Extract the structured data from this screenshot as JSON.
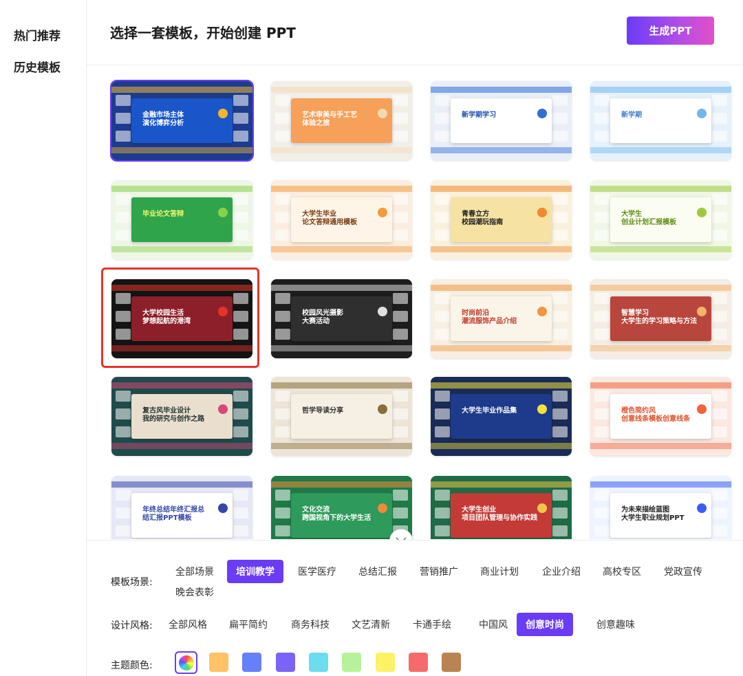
{
  "sidebar": {
    "items": [
      {
        "label": "热门推荐"
      },
      {
        "label": "历史模板"
      }
    ]
  },
  "header": {
    "title": "选择一套模板，开始创建 PPT",
    "generate_label": "生成PPT"
  },
  "templates": [
    {
      "title": "金融市场主体\n演化博弈分析",
      "bg": "#1d3c8f",
      "panel": "#1a56c9",
      "accent": "#f3b52c",
      "text": "#ffffff"
    },
    {
      "title": "艺术审美与手工艺\n体验之旅",
      "bg": "#f2efe9",
      "panel": "#f6a05a",
      "accent": "#f4d9b5",
      "text": "#ffffff"
    },
    {
      "title": "新学期学习",
      "bg": "#e9eef7",
      "panel": "#ffffff",
      "accent": "#2f6fd6",
      "text": "#1e4fb3"
    },
    {
      "title": "新学期",
      "bg": "#e6f1fb",
      "panel": "#ffffff",
      "accent": "#6fb7ee",
      "text": "#3d7fd0"
    },
    {
      "title": "毕业论文答辩",
      "bg": "#eef6e6",
      "panel": "#2fa44b",
      "accent": "#89d14b",
      "text": "#f4f86a"
    },
    {
      "title": "大学生毕业\n论文答辩通用模板",
      "bg": "#fbeee1",
      "panel": "#fff4e8",
      "accent": "#f29a3c",
      "text": "#7a3b10"
    },
    {
      "title": "青春立方\n校园潮玩指南",
      "bg": "#faf1dd",
      "panel": "#f6e2a3",
      "accent": "#f08a2d",
      "text": "#222222"
    },
    {
      "title": "大学生\n创业计划汇报模板",
      "bg": "#f1f7e6",
      "panel": "#fbfdf2",
      "accent": "#9ccb3c",
      "text": "#5f8f14"
    },
    {
      "title": "大学校园生活\n梦想起航的港湾",
      "bg": "#141414",
      "panel": "#8c1f2a",
      "accent": "#e6332a",
      "text": "#ffffff"
    },
    {
      "title": "校园风光摄影\n大赛活动",
      "bg": "#1d1d1d",
      "panel": "#2f2f2f",
      "accent": "#e0e0e0",
      "text": "#ffffff"
    },
    {
      "title": "时尚前沿\n潮流服饰产品介绍",
      "bg": "#f7efe2",
      "panel": "#fbf4e8",
      "accent": "#f09640",
      "text": "#c0392b"
    },
    {
      "title": "智慧学习\n大学生的学习策略与方法",
      "bg": "#f4ede4",
      "panel": "#b8463d",
      "accent": "#f2b36a",
      "text": "#ffffff"
    },
    {
      "title": "复古风毕业设计\n我的研究与创作之路",
      "bg": "#1f4b4b",
      "panel": "#eadfcf",
      "accent": "#d8477a",
      "text": "#233"
    },
    {
      "title": "哲学导读分享",
      "bg": "#ece4d6",
      "panel": "#f6f0e4",
      "accent": "#8a6d3b",
      "text": "#333333"
    },
    {
      "title": "大学生毕业作品集",
      "bg": "#1b2b57",
      "panel": "#1e3a8a",
      "accent": "#f4e23a",
      "text": "#ffffff"
    },
    {
      "title": "橙色简约风\n创意线条模板创意线条",
      "bg": "#fbe8e0",
      "panel": "#ffffff",
      "accent": "#f0643c",
      "text": "#e0532c"
    },
    {
      "title": "年终总结年终汇报总\n结汇报PPT模板",
      "bg": "#e6e8f6",
      "panel": "#ffffff",
      "accent": "#3446a8",
      "text": "#3446a8"
    },
    {
      "title": "文化交流\n跨国视角下的大学生活",
      "bg": "#1f7a48",
      "panel": "#2e9a5b",
      "accent": "#ef8a3c",
      "text": "#ffffff"
    },
    {
      "title": "大学生创业\n项目团队管理与协作实践",
      "bg": "#1e6b46",
      "panel": "#c33a36",
      "accent": "#f2c54a",
      "text": "#ffffff"
    },
    {
      "title": "为未来描绘蓝图\n大学生职业规划PPT",
      "bg": "#eef4ff",
      "panel": "#ffffff",
      "accent": "#3b5cf6",
      "text": "#222222"
    }
  ],
  "filters": {
    "scene": {
      "label": "模板场景:",
      "options": [
        "全部场景",
        "培训教学",
        "医学医疗",
        "总结汇报",
        "营销推广",
        "商业计划",
        "企业介绍",
        "高校专区",
        "党政宣传",
        "晚会表彰"
      ],
      "selected": "培训教学"
    },
    "style": {
      "label": "设计风格:",
      "options": [
        "全部风格",
        "扁平简约",
        "商务科技",
        "文艺清新",
        "卡通手绘",
        "中国风",
        "创意时尚",
        "创意趣味"
      ],
      "selected": "创意时尚"
    },
    "color": {
      "label": "主题颜色:",
      "swatches": [
        "#ffc266",
        "#6680f8",
        "#7a63f5",
        "#6ddcee",
        "#b7f29a",
        "#fbf266",
        "#f56b6b",
        "#b98452"
      ]
    }
  },
  "colors": {
    "accent": "#6a3cf6",
    "highlight": "#e6332a"
  }
}
